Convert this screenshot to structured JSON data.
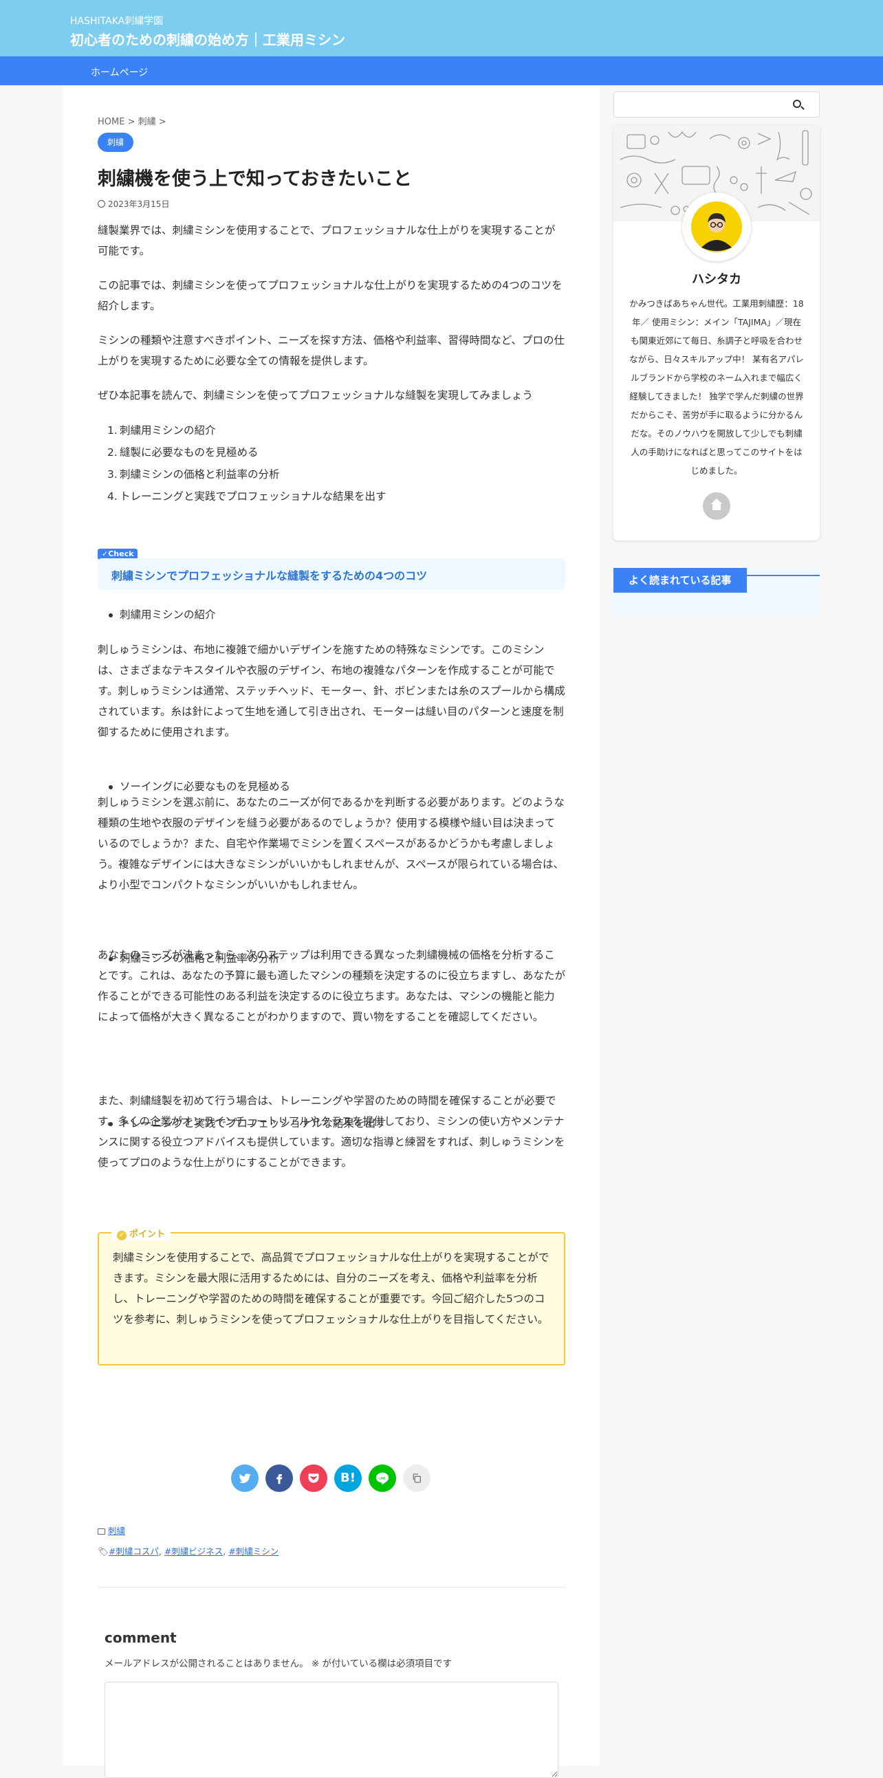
{
  "header": {
    "site_sub": "HASHITAKA刺繍学園",
    "site_title": "初心者のための刺繍の始め方｜工業用ミシン"
  },
  "nav": {
    "home": "ホームページ"
  },
  "article": {
    "breadcrumb": "HOME > 刺繍 >",
    "category": "刺繍",
    "title": "刺繍機を使う上で知っておきたいこと",
    "date": "2023年3月15日",
    "intro": [
      "縫製業界では、刺繍ミシンを使用することで、プロフェッショナルな仕上がりを実現することが可能です。",
      "この記事では、刺繍ミシンを使ってプロフェッショナルな仕上がりを実現するための4つのコツを紹介します。",
      "ミシンの種類や注意すべきポイント、ニーズを探す方法、価格や利益率、習得時間など、プロの仕上がりを実現するために必要な全ての情報を提供します。",
      "ぜひ本記事を読んで、刺繍ミシンを使ってプロフェッショナルな縫製を実現してみましょう"
    ],
    "list": [
      {
        "num": "1.",
        "text": "刺繍用ミシンの紹介"
      },
      {
        "num": "2.",
        "text": "縫製に必要なものを見極める"
      },
      {
        "num": "3.",
        "text": "刺繍ミシンの価格と利益率の分析"
      },
      {
        "num": "4.",
        "text": "トレーニングと実践でプロフェッショナルな結果を出す"
      }
    ],
    "check_tag": "Check",
    "check_heading": "刺繍ミシンでプロフェッショナルな縫製をするための4つのコツ",
    "sections": [
      {
        "bullet": "刺繍用ミシンの紹介",
        "body": "刺しゅうミシンは、布地に複雑で細かいデザインを施すための特殊なミシンです。このミシンは、さまざまなテキスタイルや衣服のデザイン、布地の複雑なパターンを作成することが可能です。刺しゅうミシンは通常、ステッチヘッド、モーター、針、ボビンまたは糸のスプールから構成されています。糸は針によって生地を通して引き出され、モーターは縫い目のパターンと速度を制御するために使用されます。"
      },
      {
        "bullet": "ソーイングに必要なものを見極める",
        "body": "刺しゅうミシンを選ぶ前に、あなたのニーズが何であるかを判断する必要があります。どのような種類の生地や衣服のデザインを縫う必要があるのでしょうか？使用する模様や縫い目は決まっているのでしょうか？また、自宅や作業場でミシンを置くスペースがあるかどうかも考慮しましょう。複雑なデザインには大きなミシンがいいかもしれませんが、スペースが限られている場合は、より小型でコンパクトなミシンがいいかもしれません。"
      },
      {
        "bullet": "刺繍ミシンの価格と利益率の分析",
        "body": "あなたのニーズが決まったら、次のステップは利用できる異なった刺繍機械の価格を分析することです。これは、あなたの予算に最も適したマシンの種類を決定するのに役立ちますし、あなたが作ることができる可能性のある利益を決定するのに役立ちます。あなたは、マシンの機能と能力によって価格が大きく異なることがわかりますので、買い物をすることを確認してください。"
      },
      {
        "bullet": "トレーニングと実践でプロフェッショナルな結果を出す",
        "body": "また、刺繍縫製を初めて行う場合は、トレーニングや学習のための時間を確保することが必要です。多くの企業がオンラインチュートリアルやクラスを提供しており、ミシンの使い方やメンテナンスに関する役立つアドバイスも提供しています。適切な指導と練習をすれば、刺しゅうミシンを使ってプロのような仕上がりにすることができます。"
      }
    ],
    "point_label": "ポイント",
    "point_text": "刺繍ミシンを使用することで、高品質でプロフェッショナルな仕上がりを実現することができます。ミシンを最大限に活用するためには、自分のニーズを考え、価格や利益率を分析し、トレーニングや学習のための時間を確保することが重要です。今回ご紹介した5つのコツを参考に、刺しゅうミシンを使ってプロフェッショナルな仕上がりを目指してください。",
    "share": {
      "hatena": "B!",
      "twitter_color": "#55acee",
      "facebook_color": "#3b5998",
      "pocket_color": "#ef3f56",
      "hatena_color": "#00a4de",
      "line_color": "#00c300"
    },
    "category_meta": "刺繍",
    "tags": [
      "#刺繍コスパ",
      "#刺繍ビジネス",
      "#刺繍ミシン"
    ],
    "tag_separator": ", "
  },
  "comment": {
    "title": "comment",
    "note": "メールアドレスが公開されることはありません。 ※ が付いている欄は必須項目です"
  },
  "sidebar": {
    "profile_name": "ハシタカ",
    "profile_bio": "かみつきばあちゃん世代。工業用刺繍歴：18年／ 使用ミシン：メイン「TAJIMA」／現在も関東近郊にて毎日、糸調子と呼吸を合わせながら、日々スキルアップ中！ 某有名アパレルブランドから学校のネーム入れまで幅広く経験してきました！ 独学で学んだ刺繍の世界だからこそ、苦労が手に取るように分かるんだな。そのノウハウを開放して少しでも刺繍人の手助けになればと思ってこのサイトをはじめました。",
    "popular_title": "よく読まれている記事"
  },
  "colors": {
    "header_bg": "#7dcdf0",
    "nav_bg": "#3b82f6",
    "accent": "#3b82f6",
    "point_border": "#f0c840"
  }
}
